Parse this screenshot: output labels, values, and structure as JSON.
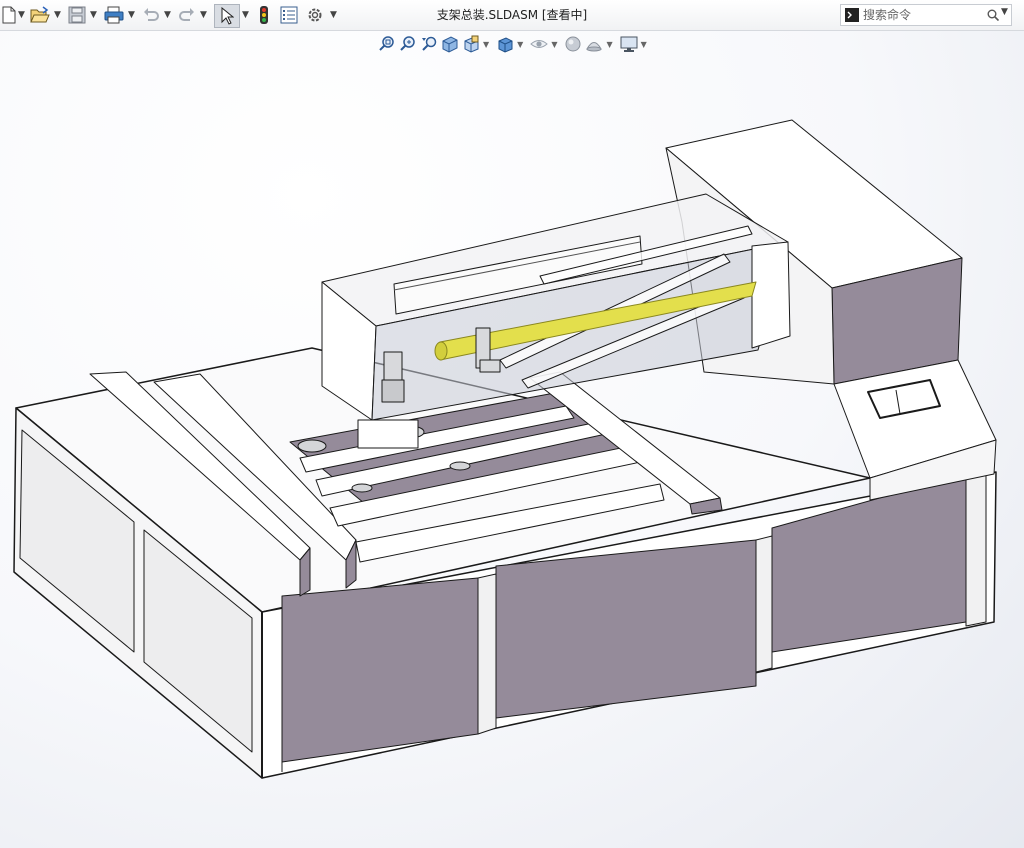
{
  "window": {
    "title": "支架总装.SLDASM [查看中]"
  },
  "toolbar": {
    "items": [
      "new-document",
      "open",
      "save",
      "print",
      "undo",
      "redo",
      "select",
      "rebuild",
      "file-properties",
      "options"
    ]
  },
  "search": {
    "placeholder": "搜索命令"
  },
  "heads_up_toolbar": {
    "items": [
      "zoom-to-fit",
      "zoom-to-area",
      "previous-view",
      "section-view",
      "view-orientation",
      "display-style",
      "hide-show-items",
      "edit-appearance",
      "apply-scene",
      "view-settings"
    ]
  },
  "colors": {
    "panel_face": "#958b9a",
    "panel_light": "#c9c3cc",
    "frame_white": "#ffffff",
    "edge": "#1a1a1a",
    "laser_tube": "#e3df4c",
    "glass": "#c7cbd6",
    "background": "#eef0f5"
  }
}
